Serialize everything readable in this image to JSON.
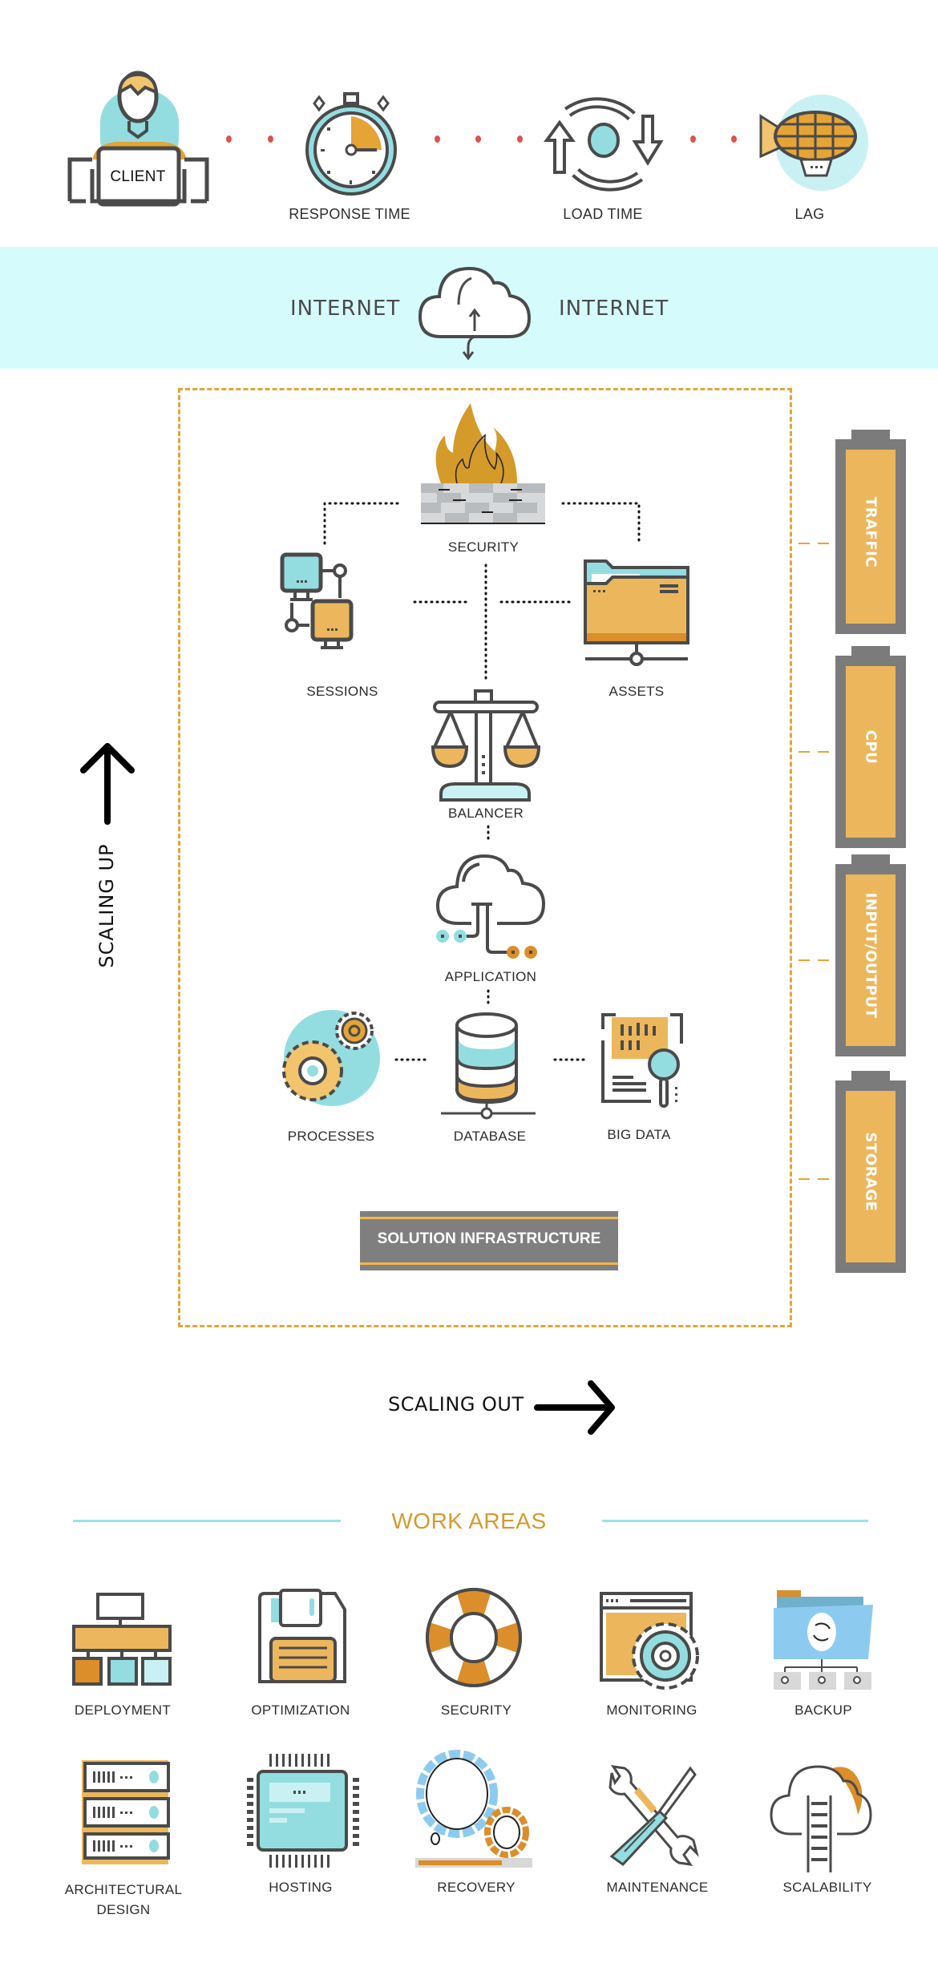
{
  "top_row": {
    "client_label": "CLIENT",
    "metrics": [
      {
        "id": "response-time",
        "label": "RESPONSE TIME",
        "icon": "stopwatch-icon"
      },
      {
        "id": "load-time",
        "label": "LOAD TIME",
        "icon": "refresh-cycle-icon"
      },
      {
        "id": "lag",
        "label": "LAG",
        "icon": "airship-icon"
      }
    ]
  },
  "internet": {
    "left_label": "INTERNET",
    "right_label": "INTERNET",
    "icon": "cloud-transfer-icon"
  },
  "infrastructure": {
    "nodes": {
      "security": "SECURITY",
      "sessions": "SESSIONS",
      "assets": "ASSETS",
      "balancer": "BALANCER",
      "application": "APPLICATION",
      "processes": "PROCESSES",
      "database": "DATABASE",
      "big_data": "BIG DATA"
    },
    "banner": "SOLUTION INFRASTRUCTURE"
  },
  "resources": [
    {
      "label": "TRAFFIC"
    },
    {
      "label": "CPU"
    },
    {
      "label": "INPUT/OUTPUT"
    },
    {
      "label": "STORAGE"
    }
  ],
  "scaling": {
    "up_label": "SCALING UP",
    "out_label": "SCALING OUT"
  },
  "work_areas": {
    "title": "WORK AREAS",
    "items": [
      {
        "label": "DEPLOYMENT",
        "icon": "hierarchy-icon"
      },
      {
        "label": "OPTIMIZATION",
        "icon": "floppy-disk-icon"
      },
      {
        "label": "SECURITY",
        "icon": "lifebuoy-icon"
      },
      {
        "label": "MONITORING",
        "icon": "window-gear-icon"
      },
      {
        "label": "BACKUP",
        "icon": "folder-sync-icon"
      },
      {
        "label": "ARCHITECTURAL",
        "label2": "DESIGN",
        "icon": "server-rack-icon"
      },
      {
        "label": "HOSTING",
        "icon": "chip-icon"
      },
      {
        "label": "RECOVERY",
        "icon": "gears-progress-icon"
      },
      {
        "label": "MAINTENANCE",
        "icon": "wrench-screwdriver-icon"
      },
      {
        "label": "SCALABILITY",
        "icon": "cloud-ladder-icon"
      }
    ]
  },
  "colors": {
    "orange": "#e5a435",
    "light_orange": "#ecb75c",
    "teal": "#93dde0",
    "dark_gray": "#4a4a4a",
    "band_bg": "#d6fbfd",
    "red_dot": "#d9534f",
    "title_gold": "#d39a2f"
  }
}
